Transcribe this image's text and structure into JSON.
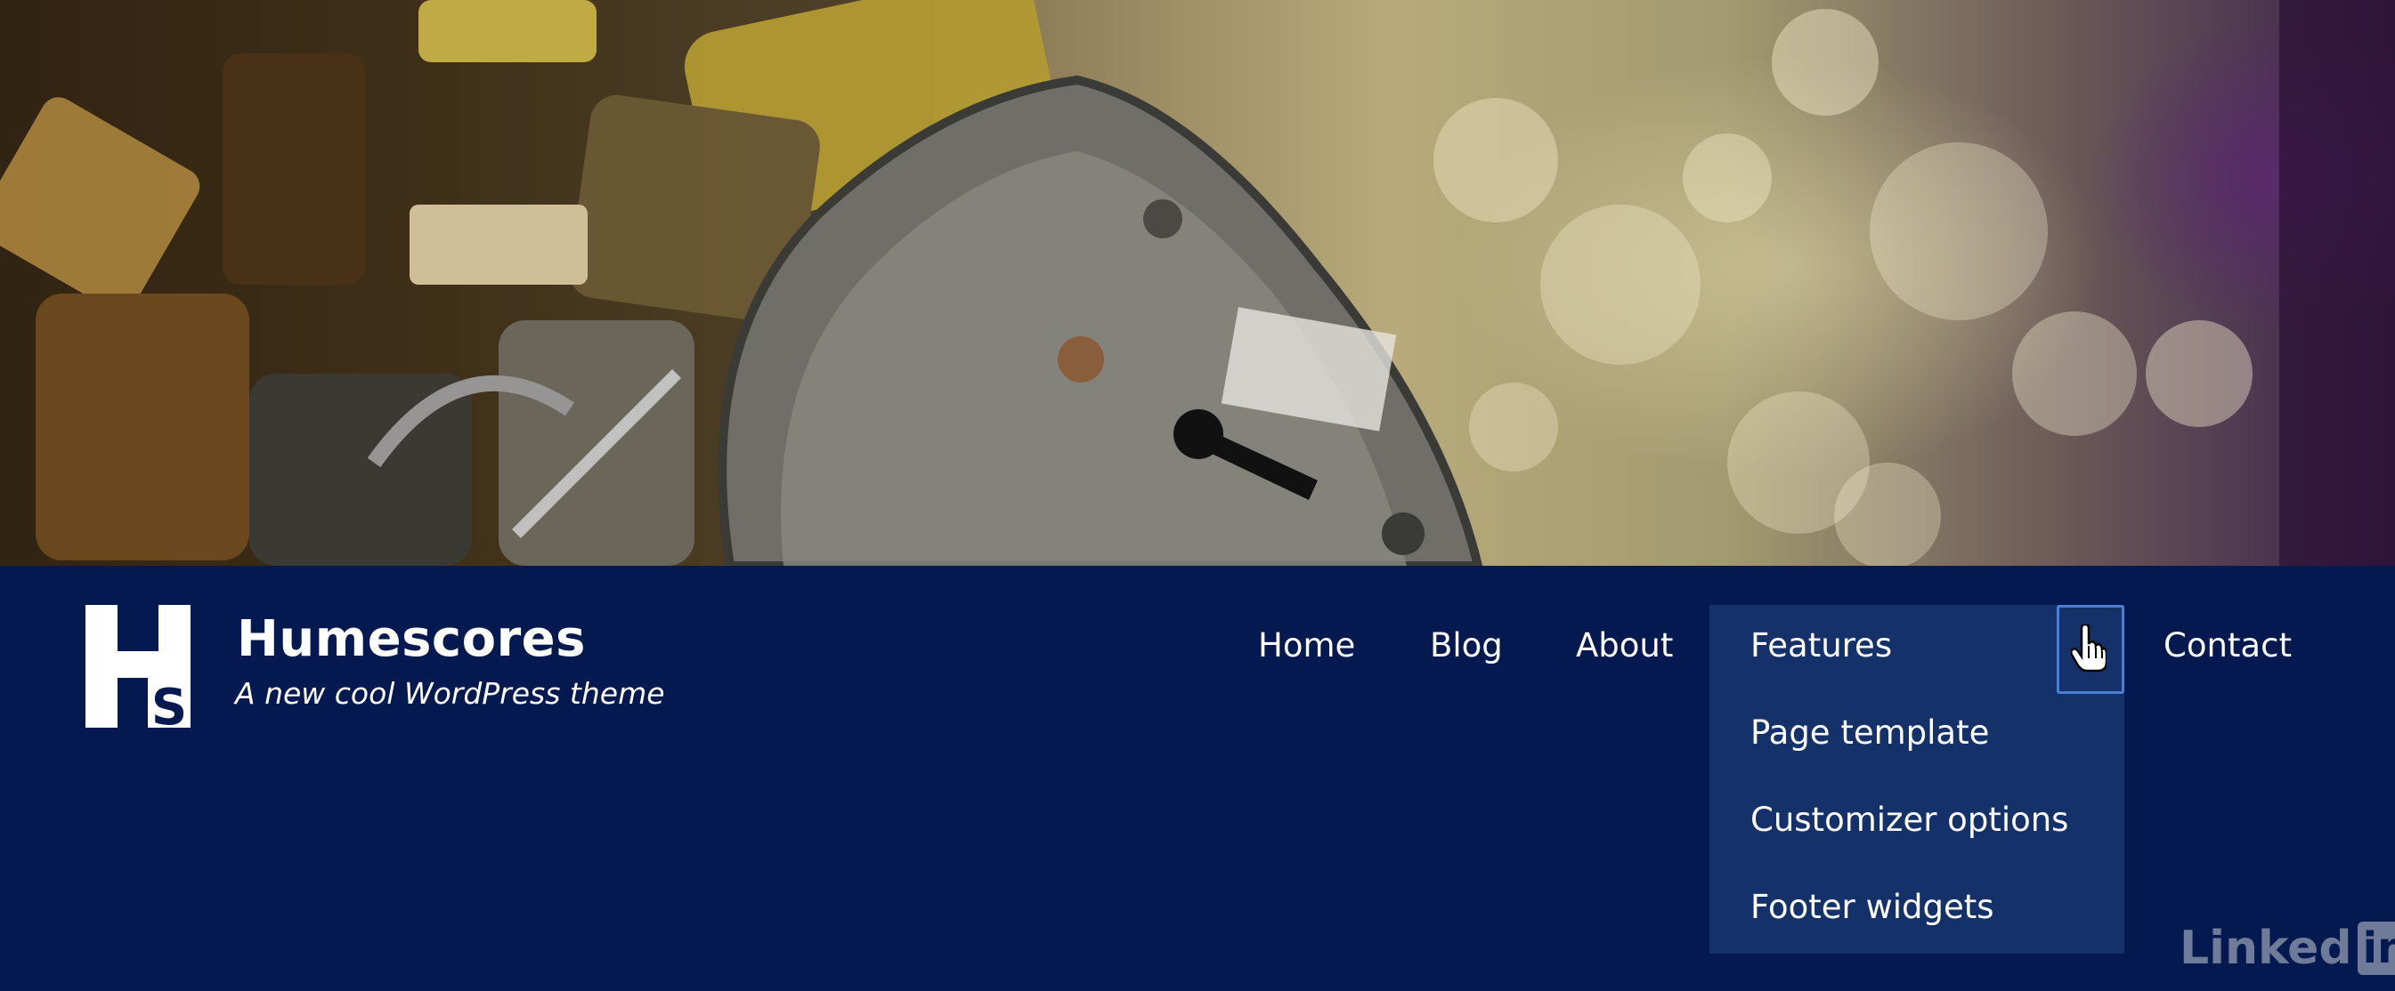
{
  "hero": {
    "image_description": ""
  },
  "site": {
    "logo_letters": "HS",
    "title": "Humescores",
    "tagline": "A new cool WordPress theme"
  },
  "nav": {
    "items": [
      {
        "label": "Home"
      },
      {
        "label": "Blog"
      },
      {
        "label": "About"
      },
      {
        "label": "Features"
      },
      {
        "label": "Contact"
      }
    ],
    "features_submenu": [
      {
        "label": "Page template"
      },
      {
        "label": "Customizer options"
      },
      {
        "label": "Footer widgets"
      }
    ]
  },
  "watermark": {
    "text": "Linked",
    "badge": "in"
  },
  "colors": {
    "header_bg": "#03194f",
    "dropdown_bg": "#15316a",
    "focus_border": "#4b7fd6",
    "text": "#ffffff"
  }
}
